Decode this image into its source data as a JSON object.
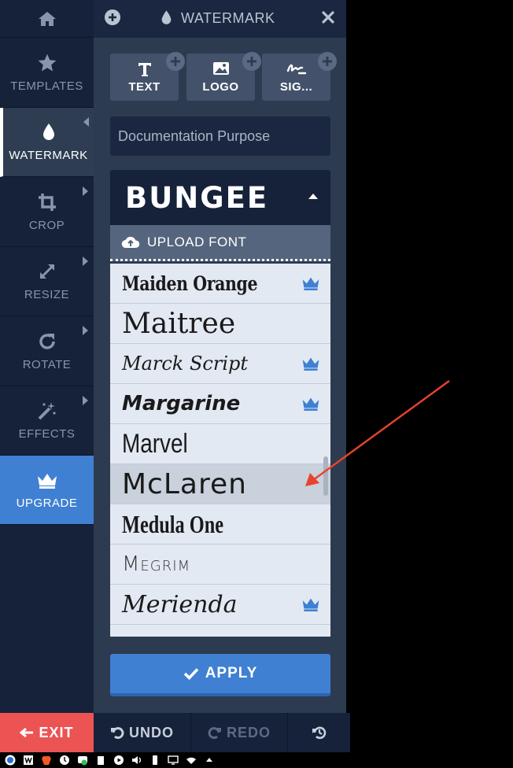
{
  "nav": {
    "templates_label": "TEMPLATES",
    "watermark_label": "WATERMARK",
    "crop_label": "CROP",
    "resize_label": "RESIZE",
    "rotate_label": "ROTATE",
    "effects_label": "EFFECTS",
    "upgrade_label": "UPGRADE"
  },
  "panel": {
    "title": "WATERMARK",
    "types": [
      {
        "label": "TEXT",
        "icon": "text-icon"
      },
      {
        "label": "LOGO",
        "icon": "image-icon"
      },
      {
        "label": "SIG...",
        "icon": "signature-icon"
      }
    ],
    "watermark_text_value": "Documentation Purpose",
    "font_current": "BUNGEE",
    "upload_font_label": "UPLOAD FONT",
    "fonts": [
      {
        "name": "Maiden Orange",
        "premium": true
      },
      {
        "name": "Maitree",
        "premium": false
      },
      {
        "name": "Marck Script",
        "premium": true
      },
      {
        "name": "Margarine",
        "premium": true
      },
      {
        "name": "Marvel",
        "premium": false
      },
      {
        "name": "McLaren",
        "premium": false,
        "selected": true
      },
      {
        "name": "Medula One",
        "premium": false
      },
      {
        "name": "Megrim",
        "premium": false
      },
      {
        "name": "Merienda",
        "premium": true
      }
    ],
    "apply_label": "APPLY"
  },
  "bottom": {
    "exit_label": "EXIT",
    "undo_label": "UNDO",
    "redo_label": "REDO"
  },
  "colors": {
    "accent": "#3f80d3",
    "exit": "#ec5454",
    "crown": "#3f80d3",
    "arrow": "#e8432c"
  }
}
